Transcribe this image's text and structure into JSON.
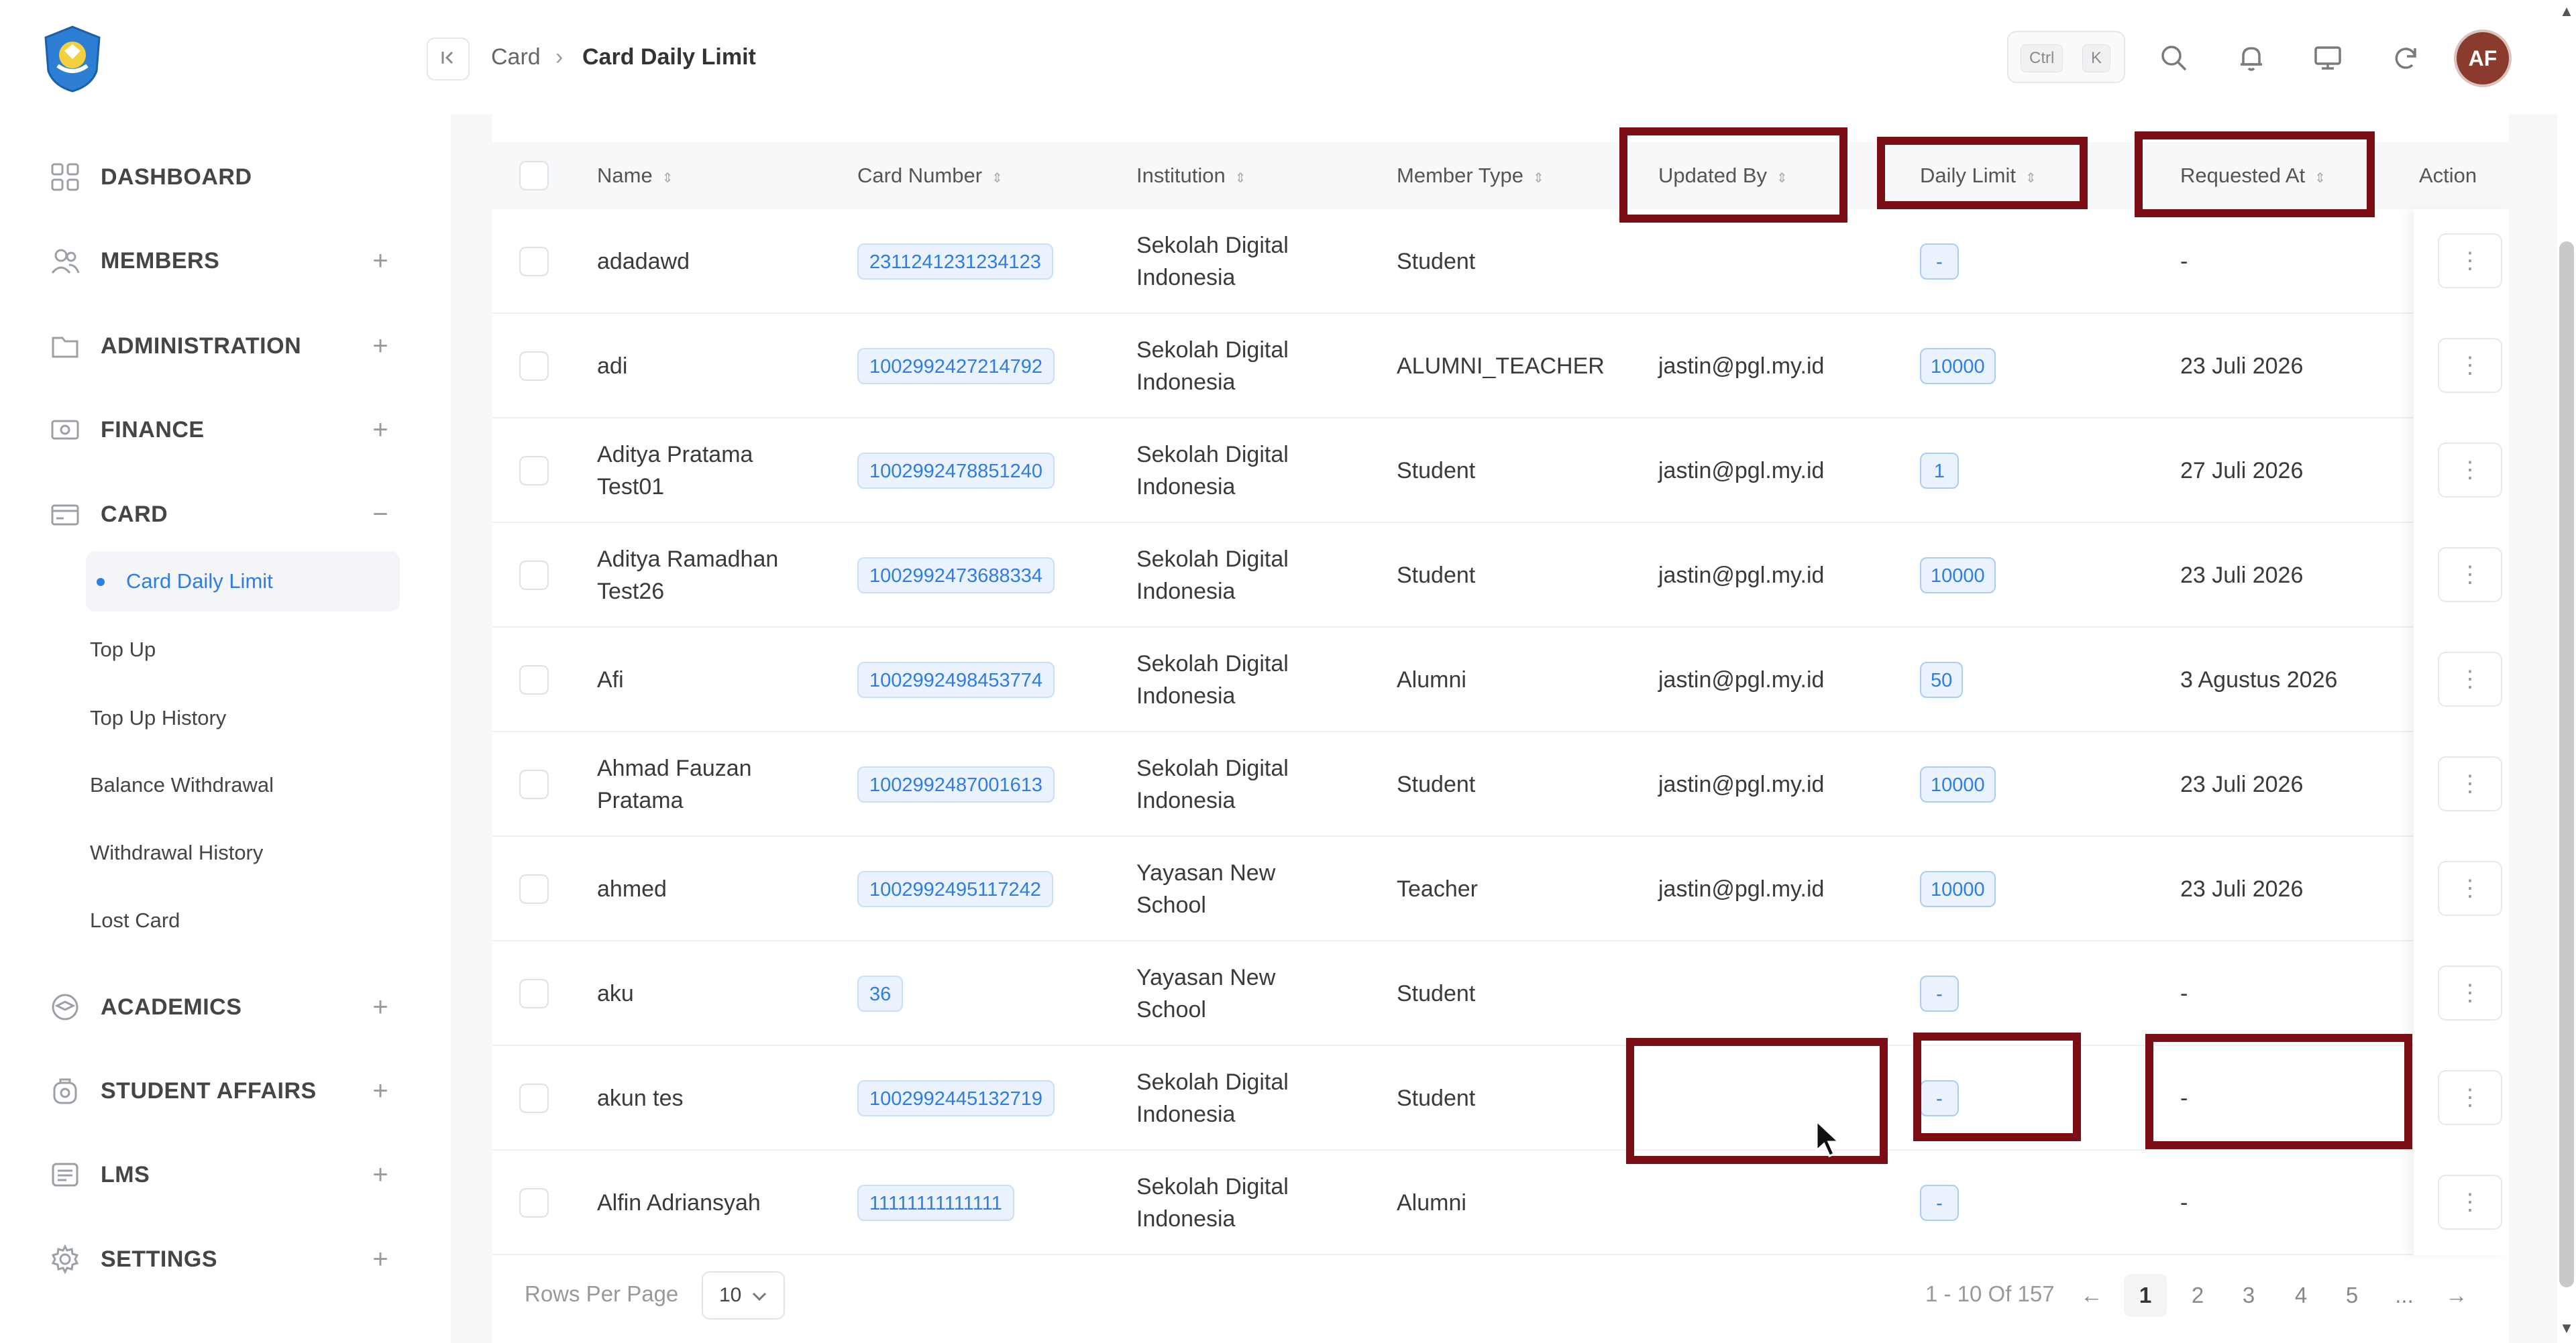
{
  "sidebar": {
    "logo_icon": "tut-wuri-handayani-logo-icon",
    "items": [
      {
        "label": "DASHBOARD",
        "icon": "grid-icon",
        "toggle": ""
      },
      {
        "label": "MEMBERS",
        "icon": "users-icon",
        "toggle": "+"
      },
      {
        "label": "ADMINISTRATION",
        "icon": "folder-icon",
        "toggle": "+"
      },
      {
        "label": "FINANCE",
        "icon": "money-icon",
        "toggle": "+"
      },
      {
        "label": "CARD",
        "icon": "card-icon",
        "toggle": "−"
      },
      {
        "label": "ACADEMICS",
        "icon": "academic-icon",
        "toggle": "+"
      },
      {
        "label": "STUDENT AFFAIRS",
        "icon": "student-icon",
        "toggle": "+"
      },
      {
        "label": "LMS",
        "icon": "lms-icon",
        "toggle": "+"
      },
      {
        "label": "SETTINGS",
        "icon": "gear-icon",
        "toggle": "+"
      }
    ],
    "card_subitems": [
      "Card Daily Limit",
      "Top Up",
      "Top Up History",
      "Balance Withdrawal",
      "Withdrawal History",
      "Lost Card"
    ]
  },
  "topbar": {
    "breadcrumb_parent": "Card",
    "breadcrumb_separator": "›",
    "breadcrumb_current": "Card Daily Limit",
    "kbd_ctrl": "Ctrl",
    "kbd_k": "K",
    "avatar_initials": "AF"
  },
  "table": {
    "columns": [
      "Name",
      "Card Number",
      "Institution",
      "Member Type",
      "Updated By",
      "Daily Limit",
      "Requested At",
      "Action"
    ],
    "rows": [
      {
        "name": [
          "adadawd"
        ],
        "card": "2311241231234123",
        "institution": [
          "Sekolah Digital",
          "Indonesia"
        ],
        "member_type": "Student",
        "updated_by": "",
        "daily_limit": "-",
        "requested_at": "-"
      },
      {
        "name": [
          "adi"
        ],
        "card": "1002992427214792",
        "institution": [
          "Sekolah Digital",
          "Indonesia"
        ],
        "member_type": "ALUMNI_TEACHER",
        "updated_by": "jastin@pgl.my.id",
        "daily_limit": "10000",
        "requested_at": "23 Juli 2026"
      },
      {
        "name": [
          "Aditya Pratama",
          "Test01"
        ],
        "card": "1002992478851240",
        "institution": [
          "Sekolah Digital",
          "Indonesia"
        ],
        "member_type": "Student",
        "updated_by": "jastin@pgl.my.id",
        "daily_limit": "1",
        "requested_at": "27 Juli 2026"
      },
      {
        "name": [
          "Aditya Ramadhan",
          "Test26"
        ],
        "card": "1002992473688334",
        "institution": [
          "Sekolah Digital",
          "Indonesia"
        ],
        "member_type": "Student",
        "updated_by": "jastin@pgl.my.id",
        "daily_limit": "10000",
        "requested_at": "23 Juli 2026"
      },
      {
        "name": [
          "Afi"
        ],
        "card": "1002992498453774",
        "institution": [
          "Sekolah Digital",
          "Indonesia"
        ],
        "member_type": "Alumni",
        "updated_by": "jastin@pgl.my.id",
        "daily_limit": "50",
        "requested_at": "3 Agustus 2026"
      },
      {
        "name": [
          "Ahmad Fauzan",
          "Pratama"
        ],
        "card": "1002992487001613",
        "institution": [
          "Sekolah Digital",
          "Indonesia"
        ],
        "member_type": "Student",
        "updated_by": "jastin@pgl.my.id",
        "daily_limit": "10000",
        "requested_at": "23 Juli 2026"
      },
      {
        "name": [
          "ahmed"
        ],
        "card": "1002992495117242",
        "institution": [
          "Yayasan New",
          "School"
        ],
        "member_type": "Teacher",
        "updated_by": "jastin@pgl.my.id",
        "daily_limit": "10000",
        "requested_at": "23 Juli 2026"
      },
      {
        "name": [
          "aku"
        ],
        "card": "36",
        "institution": [
          "Yayasan New",
          "School"
        ],
        "member_type": "Student",
        "updated_by": "",
        "daily_limit": "-",
        "requested_at": "-"
      },
      {
        "name": [
          "akun tes"
        ],
        "card": "1002992445132719",
        "institution": [
          "Sekolah Digital",
          "Indonesia"
        ],
        "member_type": "Student",
        "updated_by": "",
        "daily_limit": "-",
        "requested_at": "-"
      },
      {
        "name": [
          "Alfin Adriansyah"
        ],
        "card": "11111111111111",
        "institution": [
          "Sekolah Digital",
          "Indonesia"
        ],
        "member_type": "Alumni",
        "updated_by": "",
        "daily_limit": "-",
        "requested_at": "-"
      }
    ],
    "action_glyph": "⋮"
  },
  "footer": {
    "rows_per_page_label": "Rows Per Page",
    "rows_per_page_value": "10",
    "range": "1 - 10 Of 157",
    "prev": "←",
    "next": "→",
    "pages": [
      "1",
      "2",
      "3",
      "4",
      "5",
      "..."
    ],
    "current_page": "1"
  },
  "colors": {
    "accent": "#2f7de1",
    "annotation": "#7b0e14",
    "avatar": "#8b3a2e"
  }
}
